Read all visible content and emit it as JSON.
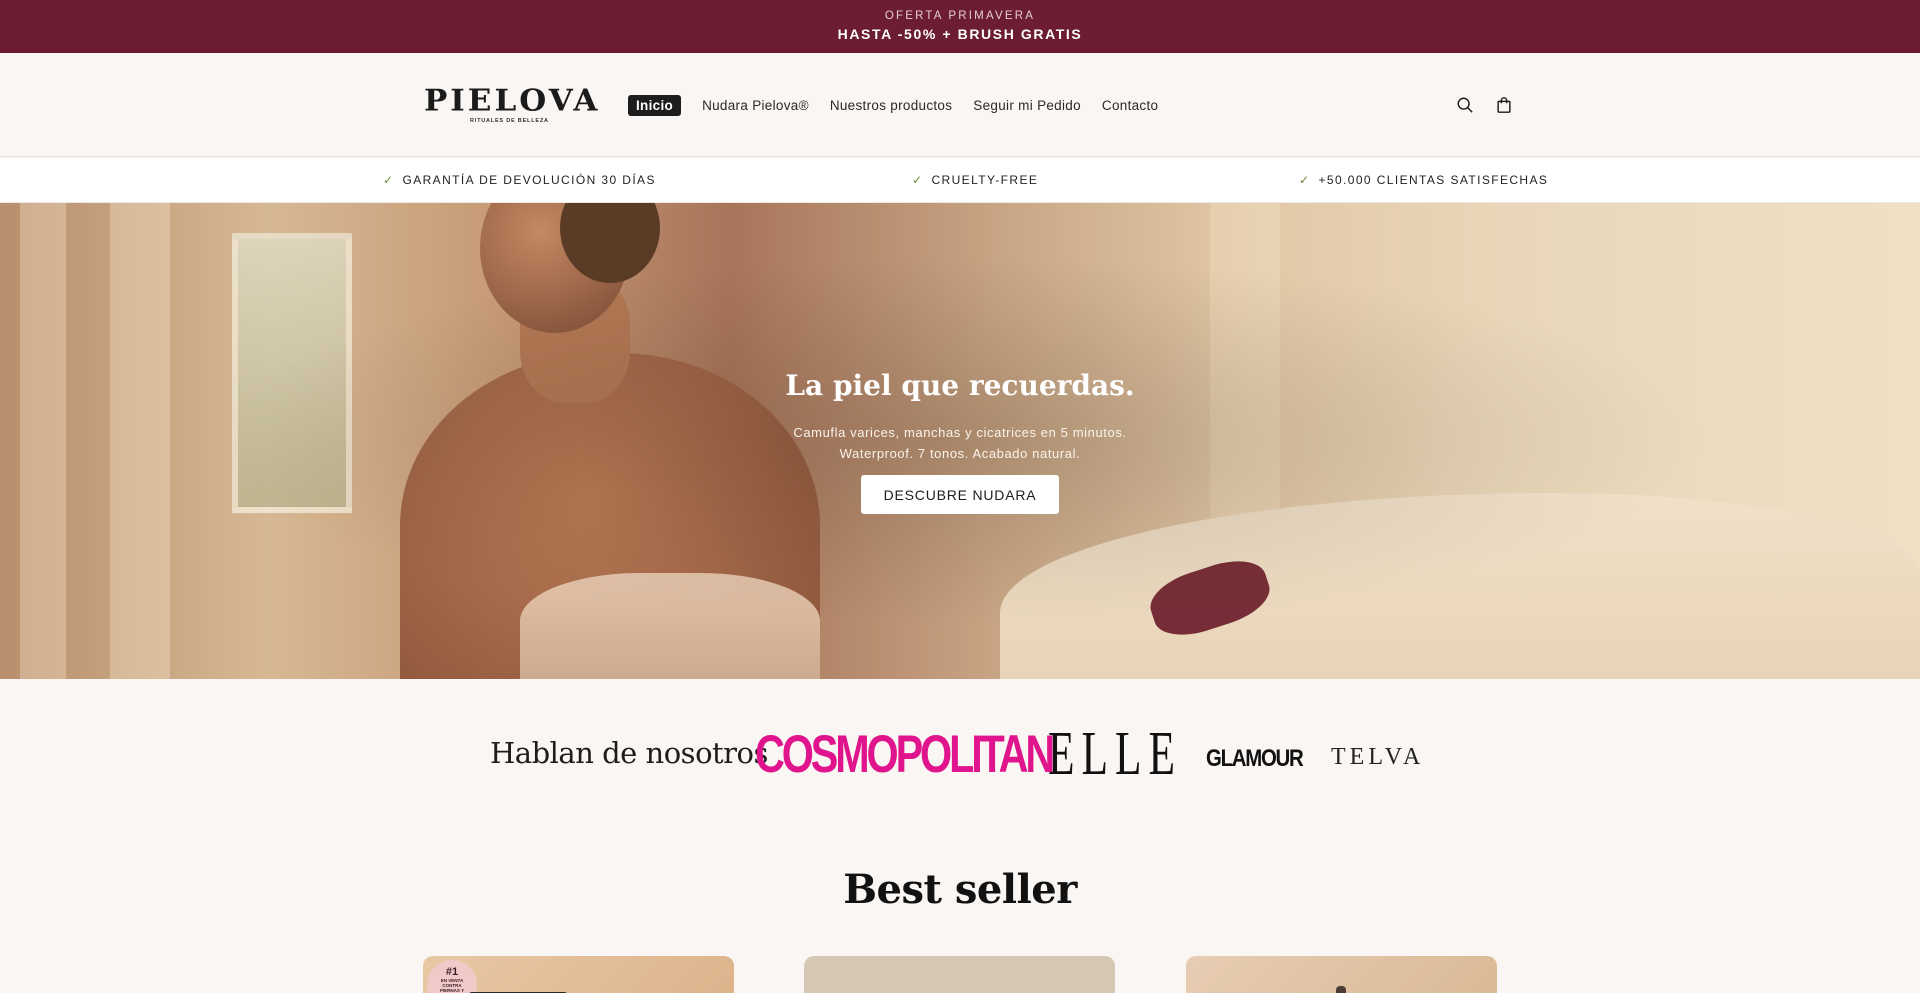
{
  "announcement": {
    "small": "OFERTA PRIMAVERA",
    "big": "HASTA -50% + BRUSH GRATIS"
  },
  "brand": {
    "logo_text": "PIELOVA",
    "tagline": "RITUALES DE BELLEZA"
  },
  "nav": {
    "items": [
      {
        "label": "Inicio",
        "active": true
      },
      {
        "label": "Nudara Pielova®"
      },
      {
        "label": "Nuestros productos"
      },
      {
        "label": "Seguir mi Pedido"
      },
      {
        "label": "Contacto"
      }
    ]
  },
  "header_icons": [
    "search-icon",
    "cart-icon"
  ],
  "trust_bar": {
    "items": [
      {
        "label": "GARANTÍA DE DEVOLUCIÓN 30 DÍAS"
      },
      {
        "label": "CRUELTY-FREE"
      },
      {
        "label": "+50.000 CLIENTAS SATISFECHAS"
      }
    ],
    "check": "✓"
  },
  "hero": {
    "title": "La piel que recuerdas.",
    "subtitle_line1": "Camufla varices, manchas y cicatrices en 5 minutos.",
    "subtitle_line2": "Waterproof. 7 tonos. Acabado natural.",
    "cta": "DESCUBRE NUDARA"
  },
  "press": {
    "label": "Hablan de nosotros",
    "logos": [
      "COSMOPOLITAN",
      "ELLE",
      "GLAMOUR",
      "TELVA"
    ]
  },
  "best_seller": {
    "title": "Best seller",
    "badge_number": "#1",
    "badge_text": "EN VENTA CONTRA PIERNAS Y BRAZOS"
  },
  "colors": {
    "announcement_bg": "#6c1d31",
    "page_bg": "#f9f6f3",
    "cosmopolitan": "#e0148c",
    "check_green": "#6a8a3b"
  }
}
